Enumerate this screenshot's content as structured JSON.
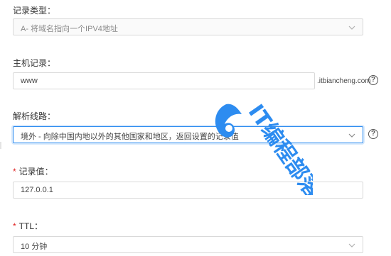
{
  "record_type": {
    "label": "记录类型：",
    "value": "A- 将域名指向一个IPV4地址"
  },
  "host_record": {
    "label": "主机记录：",
    "value": "www",
    "suffix": ".itbiancheng.com"
  },
  "line": {
    "label": "解析线路：",
    "value": "境外 - 向除中国内地以外的其他国家和地区，返回设置的记录值"
  },
  "record_value": {
    "required_mark": "*",
    "label": "记录值：",
    "value": "127.0.0.1"
  },
  "ttl": {
    "required_mark": "*",
    "label": "TTL：",
    "value": "10 分钟"
  },
  "help_glyph": "?",
  "watermark": {
    "text": "IT编程部落",
    "color": "#2d8cf0"
  },
  "colors": {
    "focus_border": "#2d8cf0",
    "required": "#e02020",
    "border": "#d9d9d9"
  }
}
